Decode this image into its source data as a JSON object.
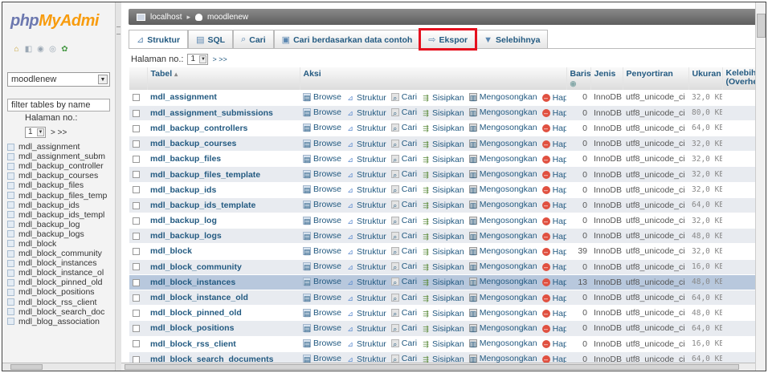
{
  "logo": {
    "part1": "php",
    "part2": "MyAdmi"
  },
  "nav_icons": [
    "home-icon",
    "logout-icon",
    "help-icon",
    "docs-icon",
    "settings-icon"
  ],
  "sidebar": {
    "db_select": "moodlenew",
    "filter_placeholder": "filter tables by name",
    "page_label": "Halaman no.:",
    "page_value": "1",
    "page_nav": "> >>",
    "tables": [
      "mdl_assignment",
      "mdl_assignment_subm",
      "mdl_backup_controller",
      "mdl_backup_courses",
      "mdl_backup_files",
      "mdl_backup_files_temp",
      "mdl_backup_ids",
      "mdl_backup_ids_templ",
      "mdl_backup_log",
      "mdl_backup_logs",
      "mdl_block",
      "mdl_block_community",
      "mdl_block_instances",
      "mdl_block_instance_ol",
      "mdl_block_pinned_old",
      "mdl_block_positions",
      "mdl_block_rss_client",
      "mdl_block_search_doc",
      "mdl_blog_association"
    ]
  },
  "breadcrumb": {
    "server": "localhost",
    "database": "moodlenew"
  },
  "tabs": {
    "struktur": "Struktur",
    "sql": "SQL",
    "cari": "Cari",
    "cari_contoh": "Cari berdasarkan data contoh",
    "ekspor": "Ekspor",
    "selebihnya": "Selebihnya"
  },
  "pagination": {
    "label": "Halaman no.:",
    "value": "1",
    "nav": "> >>"
  },
  "columns": {
    "tabel": "Tabel",
    "aksi": "Aksi",
    "baris": "Baris",
    "jenis": "Jenis",
    "penyortiran": "Penyortiran",
    "ukuran": "Ukuran",
    "kelebihan": "Kelebiha (Overhe"
  },
  "actions": {
    "browse": "Browse",
    "struktur": "Struktur",
    "cari": "Cari",
    "sisipkan": "Sisipkan",
    "mengosongkan": "Mengosongkan",
    "hapus": "Hapus"
  },
  "rows": [
    {
      "name": "mdl_assignment",
      "rows": "0",
      "engine": "InnoDB",
      "collation": "utf8_unicode_ci",
      "size": "32,0 KB"
    },
    {
      "name": "mdl_assignment_submissions",
      "rows": "0",
      "engine": "InnoDB",
      "collation": "utf8_unicode_ci",
      "size": "80,0 KB"
    },
    {
      "name": "mdl_backup_controllers",
      "rows": "0",
      "engine": "InnoDB",
      "collation": "utf8_unicode_ci",
      "size": "64,0 KB"
    },
    {
      "name": "mdl_backup_courses",
      "rows": "0",
      "engine": "InnoDB",
      "collation": "utf8_unicode_ci",
      "size": "32,0 KB"
    },
    {
      "name": "mdl_backup_files",
      "rows": "0",
      "engine": "InnoDB",
      "collation": "utf8_unicode_ci",
      "size": "32,0 KB"
    },
    {
      "name": "mdl_backup_files_template",
      "rows": "0",
      "engine": "InnoDB",
      "collation": "utf8_unicode_ci",
      "size": "32,0 KB"
    },
    {
      "name": "mdl_backup_ids",
      "rows": "0",
      "engine": "InnoDB",
      "collation": "utf8_unicode_ci",
      "size": "32,0 KB"
    },
    {
      "name": "mdl_backup_ids_template",
      "rows": "0",
      "engine": "InnoDB",
      "collation": "utf8_unicode_ci",
      "size": "64,0 KB"
    },
    {
      "name": "mdl_backup_log",
      "rows": "0",
      "engine": "InnoDB",
      "collation": "utf8_unicode_ci",
      "size": "32,0 KB"
    },
    {
      "name": "mdl_backup_logs",
      "rows": "0",
      "engine": "InnoDB",
      "collation": "utf8_unicode_ci",
      "size": "48,0 KB"
    },
    {
      "name": "mdl_block",
      "rows": "39",
      "engine": "InnoDB",
      "collation": "utf8_unicode_ci",
      "size": "32,0 KB"
    },
    {
      "name": "mdl_block_community",
      "rows": "0",
      "engine": "InnoDB",
      "collation": "utf8_unicode_ci",
      "size": "16,0 KB"
    },
    {
      "name": "mdl_block_instances",
      "rows": "13",
      "engine": "InnoDB",
      "collation": "utf8_unicode_ci",
      "size": "48,0 KB"
    },
    {
      "name": "mdl_block_instance_old",
      "rows": "0",
      "engine": "InnoDB",
      "collation": "utf8_unicode_ci",
      "size": "64,0 KB"
    },
    {
      "name": "mdl_block_pinned_old",
      "rows": "0",
      "engine": "InnoDB",
      "collation": "utf8_unicode_ci",
      "size": "48,0 KB"
    },
    {
      "name": "mdl_block_positions",
      "rows": "0",
      "engine": "InnoDB",
      "collation": "utf8_unicode_ci",
      "size": "64,0 KB"
    },
    {
      "name": "mdl_block_rss_client",
      "rows": "0",
      "engine": "InnoDB",
      "collation": "utf8_unicode_ci",
      "size": "16,0 KB"
    },
    {
      "name": "mdl_block_search_documents",
      "rows": "0",
      "engine": "InnoDB",
      "collation": "utf8_unicode_ci",
      "size": "64,0 KB"
    }
  ],
  "highlight_color": "#e5101e"
}
